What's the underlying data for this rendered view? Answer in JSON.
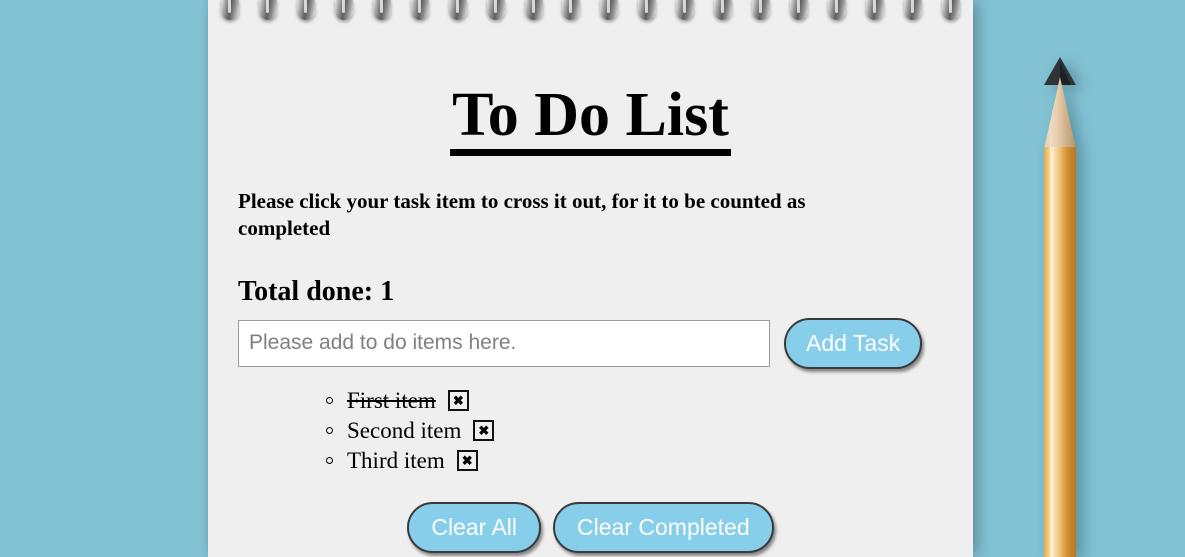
{
  "app": {
    "title": "To Do List",
    "subtitle": "Please click your task item to cross it out, for it to be counted as completed"
  },
  "counter": {
    "label": "Total done:",
    "value": "1",
    "text": "Total done: 1"
  },
  "input": {
    "placeholder": "Please add to do items here.",
    "value": ""
  },
  "buttons": {
    "add_task": "Add Task",
    "clear_all": "Clear All",
    "clear_completed": "Clear Completed",
    "delete_glyph": "✖"
  },
  "tasks": [
    {
      "label": "First item",
      "done": true
    },
    {
      "label": "Second item",
      "done": false
    },
    {
      "label": "Third item",
      "done": false
    }
  ],
  "colors": {
    "background": "#82c2d4",
    "paper": "#efefef",
    "button_fill": "#87ceeb",
    "button_text": "#ffffff",
    "text": "#000000",
    "placeholder": "#808080",
    "pencil_body": "#e8a845",
    "pencil_wood": "#e4cdae",
    "pencil_tip": "#2e3338"
  },
  "decoration": {
    "spiral_rings": 20,
    "pencil": "pencil-illustration"
  }
}
